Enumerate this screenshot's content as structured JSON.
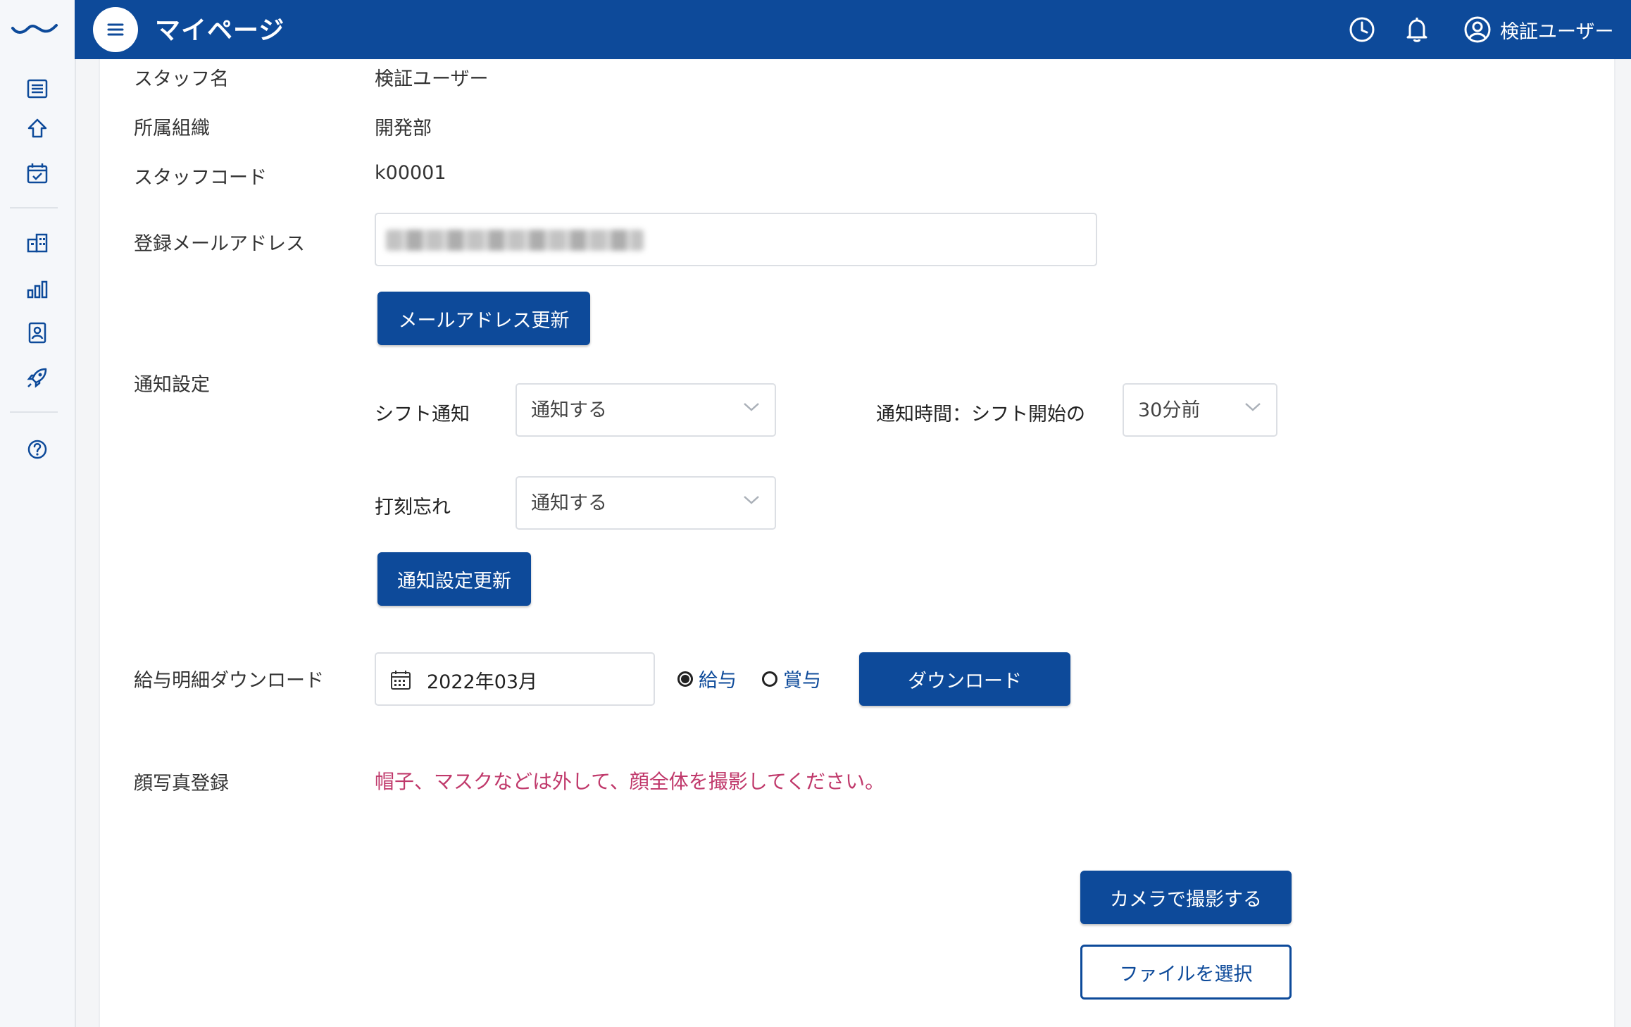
{
  "header": {
    "title": "マイページ",
    "user_name": "検証ユーザー",
    "icons": [
      "menu-icon",
      "clock-icon",
      "bell-icon",
      "user-circle-icon"
    ]
  },
  "sidebar": {
    "icons": [
      "list-icon",
      "home-icon",
      "calendar-check-icon",
      "building-icon",
      "bar-chart-icon",
      "id-card-icon",
      "rocket-icon",
      "help-icon"
    ]
  },
  "profile": {
    "staff_name_label": "スタッフ名",
    "staff_name_value": "検証ユーザー",
    "org_label": "所属組織",
    "org_value": "開発部",
    "staff_code_label": "スタッフコード",
    "staff_code_value": "k00001",
    "email_label": "登録メールアドレス",
    "email_update_button": "メールアドレス更新"
  },
  "notification": {
    "section_label": "通知設定",
    "shift_label": "シフト通知",
    "shift_value": "通知する",
    "time_label": "通知時間：シフト開始の",
    "time_value": "30分前",
    "clock_label": "打刻忘れ",
    "clock_value": "通知する",
    "update_button": "通知設定更新"
  },
  "payslip": {
    "label": "給与明細ダウンロード",
    "month_value": "2022年03月",
    "radio_salary": "給与",
    "radio_bonus": "賞与",
    "selected": "給与",
    "download_button": "ダウンロード"
  },
  "photo": {
    "label": "顔写真登録",
    "notice": "帽子、マスクなどは外して、顔全体を撮影してください。",
    "camera_button": "カメラで撮影する",
    "file_button": "ファイルを選択"
  },
  "colors": {
    "primary": "#0d4a9a",
    "warning_text": "#c0396b"
  }
}
